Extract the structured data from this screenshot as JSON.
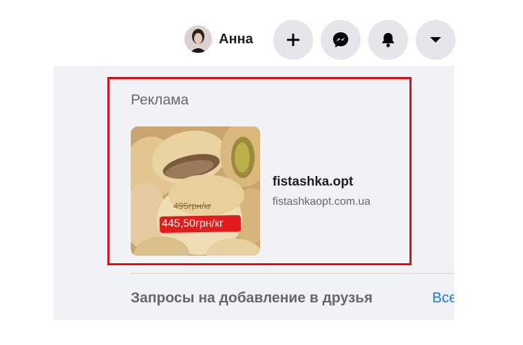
{
  "header": {
    "profile_name": "Анна",
    "buttons": [
      {
        "icon": "plus-icon"
      },
      {
        "icon": "messenger-icon"
      },
      {
        "icon": "bell-icon"
      },
      {
        "icon": "caret-down-icon"
      }
    ]
  },
  "ad": {
    "heading": "Реклама",
    "title": "fistashka.opt",
    "url": "fistashkaopt.com.ua",
    "image": {
      "old_price": "495грн/кг",
      "new_price": "445,50грн/кг"
    }
  },
  "friend_requests": {
    "title": "Запросы на добавление в друзья",
    "see_all": "Все"
  },
  "colors": {
    "highlight_border": "#e50914",
    "link": "#1877f2",
    "panel_bg": "#f0f2f5",
    "button_bg": "#e4e6eb"
  }
}
